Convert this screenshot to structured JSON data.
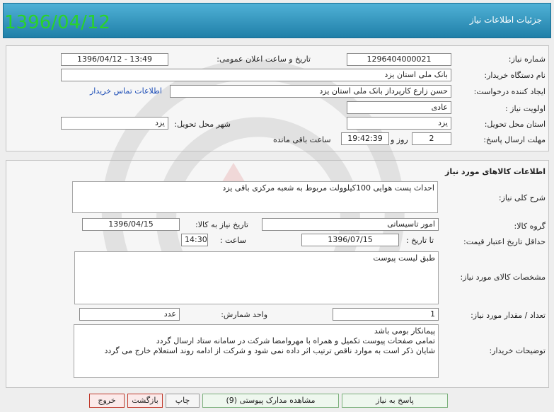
{
  "header": {
    "date": "1396/04/12",
    "title": "جزئیات اطلاعات نیاز"
  },
  "info": {
    "need_number_label": "شماره نیاز:",
    "need_number": "1296404000021",
    "announce_label": "تاریخ و ساعت اعلان عمومی:",
    "announce_value": "1396/04/12 - 13:49",
    "buyer_label": "نام دستگاه خریدار:",
    "buyer_value": "بانک ملی استان یزد",
    "creator_label": "ایجاد کننده درخواست:",
    "creator_value": "حسن زارع کارپرداز بانک ملی استان یزد",
    "contact_link": "اطلاعات تماس خریدار",
    "priority_label": "اولویت نیاز :",
    "priority_value": "عادی",
    "province_label": "استان محل تحویل:",
    "province_value": "یزد",
    "city_label": "شهر محل تحویل:",
    "city_value": "یزد",
    "deadline_label": "مهلت ارسال پاسخ:",
    "days_value": "2",
    "days_text": "روز و",
    "time_value": "19:42:39",
    "remaining_text": "ساعت باقی مانده"
  },
  "goods": {
    "section_title": "اطلاعات کالاهای مورد نیاز",
    "desc_label": "شرح کلی نیاز:",
    "desc_value": "احداث پست هوایی 100کیلوولت مربوط به شعبه مرکزی باقی یزد",
    "group_label": "گروه کالا:",
    "group_value": "امور تاسیساتی",
    "need_date_label": "تاریخ نیاز به کالا:",
    "need_date_value": "1396/04/15",
    "validity_label": "حداقل تاریخ اعتبار قیمت:",
    "until_label": "تا تاریخ :",
    "until_value": "1396/07/15",
    "hour_label": "ساعت :",
    "hour_value": "14:30",
    "spec_label": "مشخصات کالای مورد نیاز:",
    "spec_value": "طبق لیست پیوست",
    "qty_label": "تعداد / مقدار مورد نیاز:",
    "qty_value": "1",
    "unit_label": "واحد شمارش:",
    "unit_value": "عدد",
    "notes_label": "توضیحات خریدار:",
    "notes": [
      "پیمانکار بومی باشد",
      "تمامی صفحات پیوست تکمیل و همراه با مهروامضا شرکت در سامانه ستاد ارسال گردد",
      "شایان ذکر است به موارد ناقص ترتیب اثر داده نمی شود و شرکت از ادامه روند استعلام خارج می گردد"
    ]
  },
  "buttons": {
    "reply": "پاسخ به نیاز",
    "attachments": "مشاهده مدارک پیوستی (9)",
    "print": "چاپ",
    "back": "بازگشت",
    "exit": "خروج"
  },
  "colors": {
    "header_bg": "#2f93bf",
    "date_green": "#2ad32a",
    "exit_border": "#c0392b"
  }
}
